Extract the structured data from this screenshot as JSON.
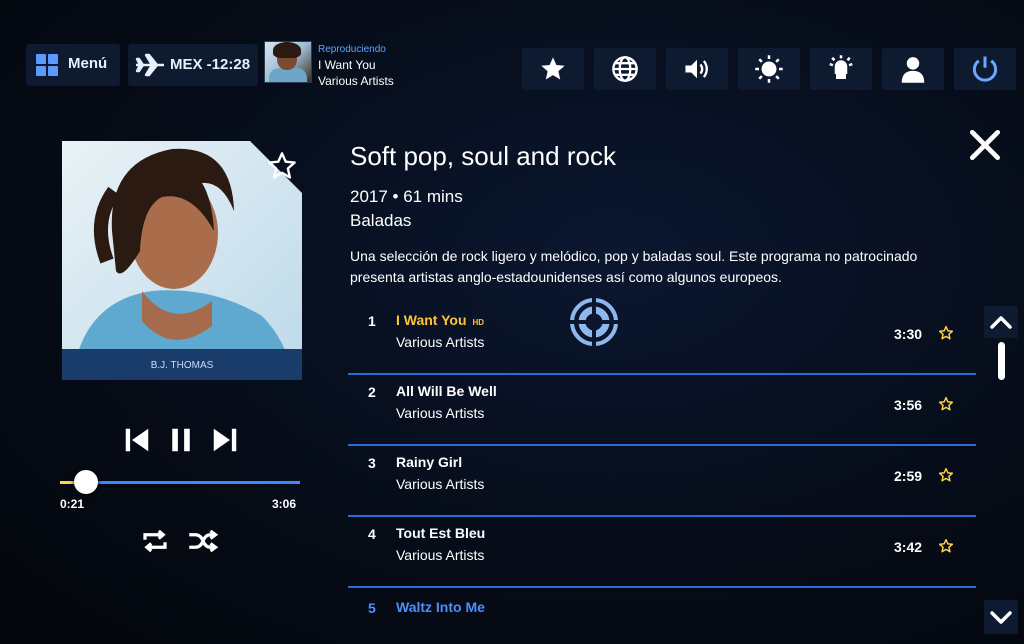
{
  "top_bar": {
    "menu_label": "Menú",
    "flight_info": "MEX -12:28",
    "now_playing": {
      "status": "Reproduciendo",
      "title": "I Want You",
      "artist": "Various Artists"
    },
    "icons": [
      "star-icon",
      "globe-icon",
      "volume-icon",
      "brightness-icon",
      "reading-light-icon",
      "attendant-call-icon",
      "power-icon"
    ]
  },
  "player": {
    "album_caption": "B.J. THOMAS",
    "current_time": "0:21",
    "total_time": "3:06",
    "progress": 0.11
  },
  "details": {
    "title": "Soft pop, soul and rock",
    "meta": "2017 • 61 mins",
    "genre": "Baladas",
    "description": "Una selección de rock ligero y melódico, pop y baladas soul. Este programa no patrocinado presenta artistas anglo-estadounidenses así como algunos europeos."
  },
  "tracks": [
    {
      "number": "1",
      "title": "I Want You",
      "hd": "HD",
      "artist": "Various Artists",
      "duration": "3:30"
    },
    {
      "number": "2",
      "title": "All Will Be Well",
      "artist": "Various Artists",
      "duration": "3:56"
    },
    {
      "number": "3",
      "title": "Rainy Girl",
      "artist": "Various Artists",
      "duration": "2:59"
    },
    {
      "number": "4",
      "title": "Tout Est Bleu",
      "artist": "Various Artists",
      "duration": "3:42"
    },
    {
      "number": "5",
      "title": "Waltz Into Me"
    }
  ],
  "colors": {
    "accent_blue": "#3c86ff",
    "active_track": "#ffc23a",
    "star_yellow": "#ffd24a"
  }
}
